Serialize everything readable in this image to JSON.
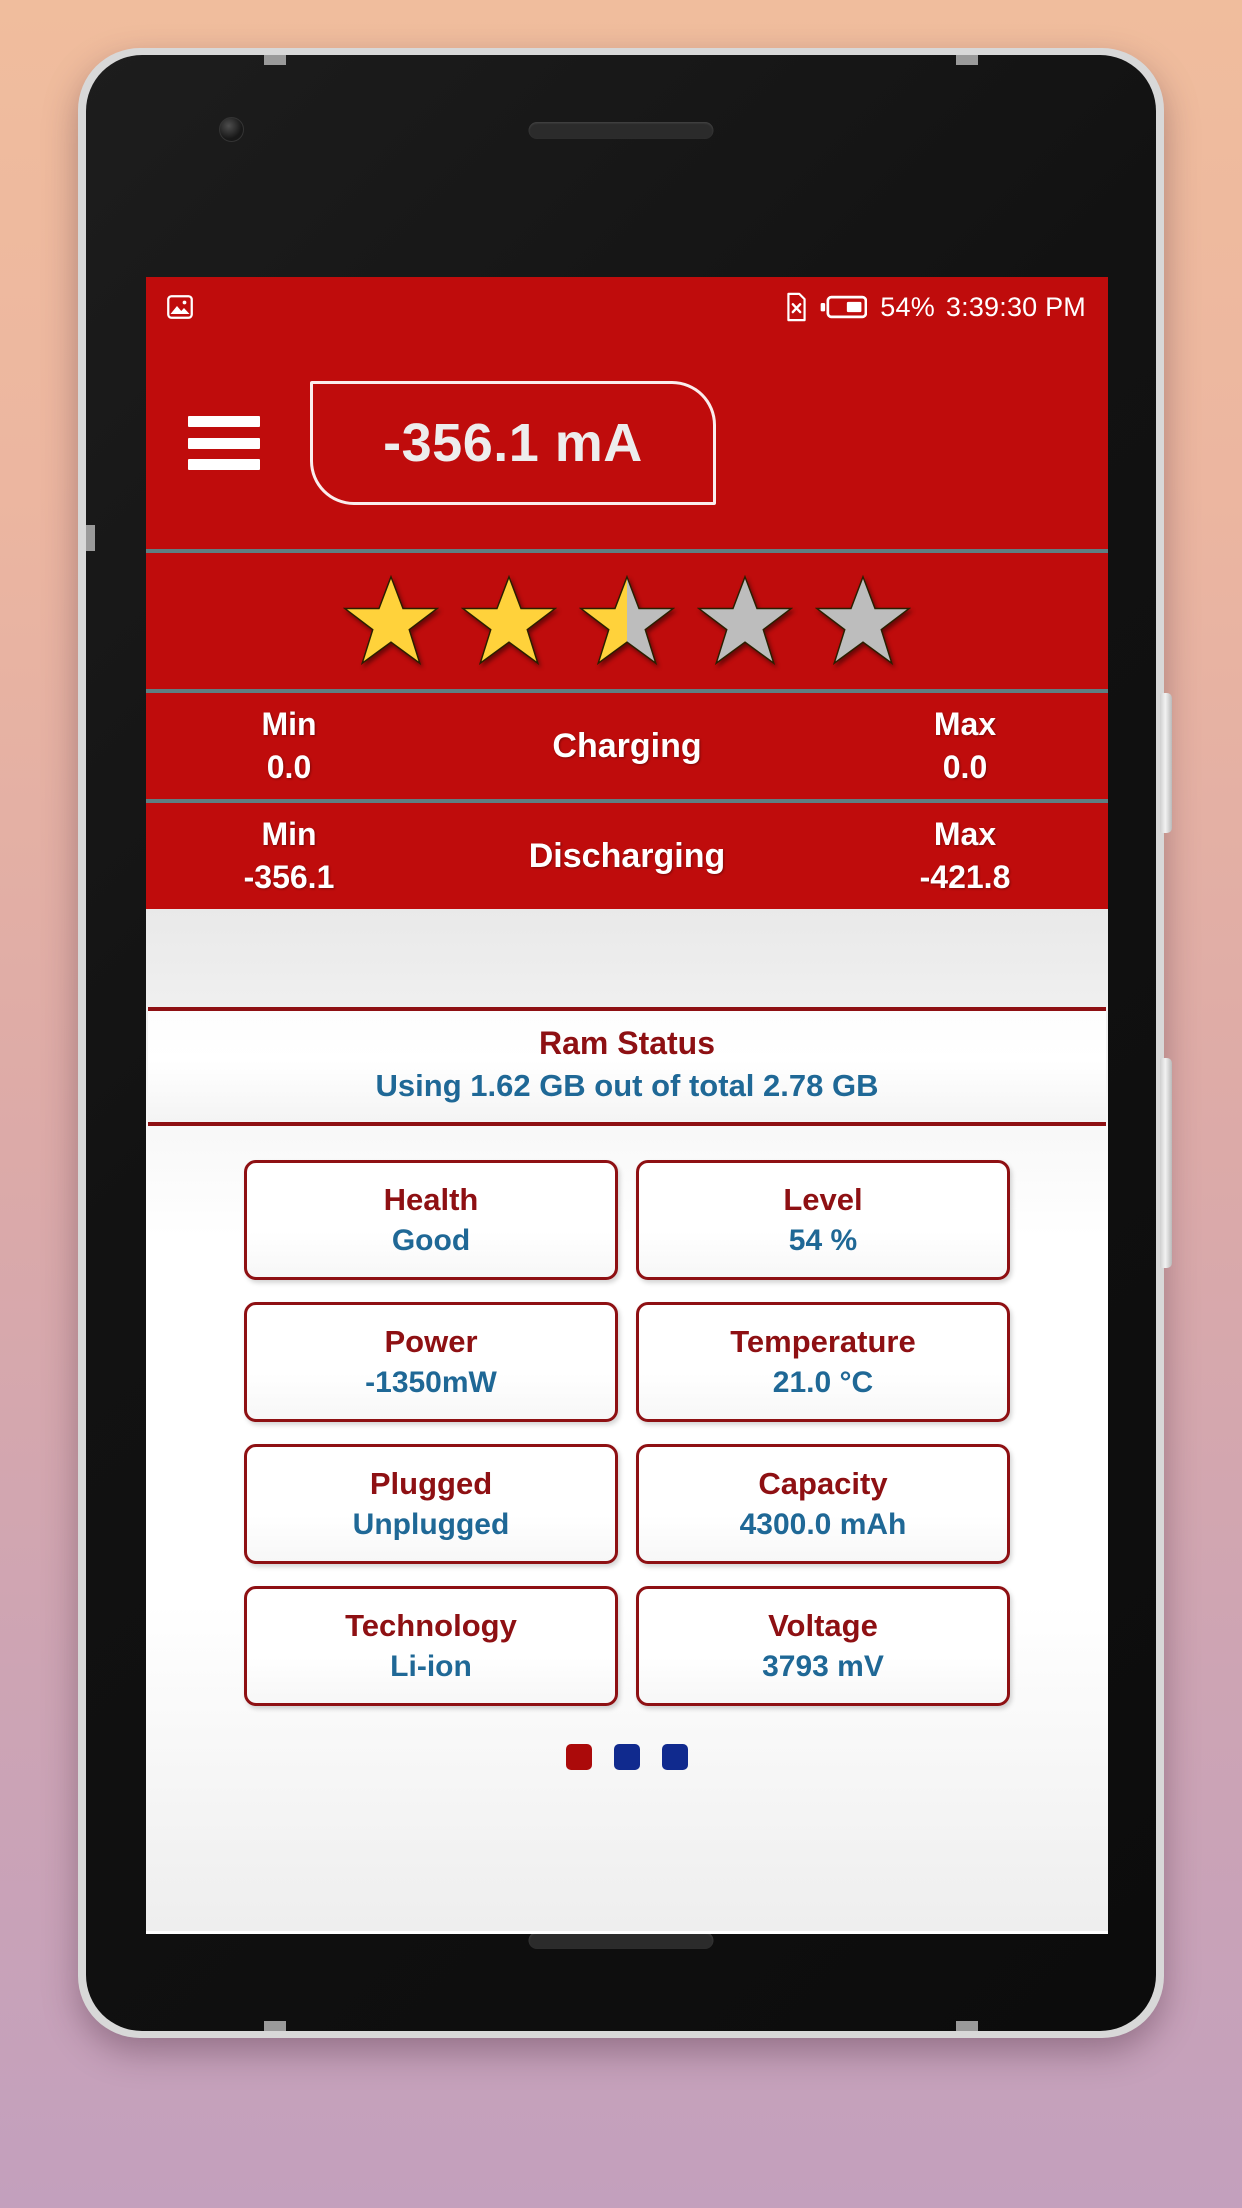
{
  "status_bar": {
    "screenshot_icon": "image-icon",
    "sim_icon": "sim-card-x-icon",
    "battery_icon": "battery-icon",
    "battery_percent": "54%",
    "time": "3:39:30 PM"
  },
  "header": {
    "menu_icon": "hamburger-menu-icon",
    "current_reading": "-356.1 mA"
  },
  "rating": {
    "stars_filled": 2.5,
    "stars_total": 5,
    "filled_color": "#FFD23B",
    "empty_color": "#BDBDBD"
  },
  "charging_row": {
    "min_label": "Min",
    "min_value": "0.0",
    "center_label": "Charging",
    "max_label": "Max",
    "max_value": "0.0"
  },
  "discharging_row": {
    "min_label": "Min",
    "min_value": "-356.1",
    "center_label": "Discharging",
    "max_label": "Max",
    "max_value": "-421.8"
  },
  "ram_status": {
    "title": "Ram Status",
    "detail": "Using 1.62 GB out of total 2.78 GB"
  },
  "info_cards": [
    {
      "label": "Health",
      "value": "Good"
    },
    {
      "label": "Level",
      "value": "54 %"
    },
    {
      "label": "Power",
      "value": "-1350mW"
    },
    {
      "label": "Temperature",
      "value": "21.0 °C"
    },
    {
      "label": "Plugged",
      "value": "Unplugged"
    },
    {
      "label": "Capacity",
      "value": "4300.0 mAh"
    },
    {
      "label": "Technology",
      "value": "Li-ion"
    },
    {
      "label": "Voltage",
      "value": "3793 mV"
    }
  ],
  "page_indicator": {
    "count": 3,
    "active_index": 0,
    "active_color": "#AB0A0A",
    "inactive_color": "#102A8E"
  },
  "theme": {
    "primary_red": "#BF0C0C",
    "dark_red": "#8E1013",
    "accent_blue": "#1F6896",
    "divider": "#5E7F82"
  }
}
